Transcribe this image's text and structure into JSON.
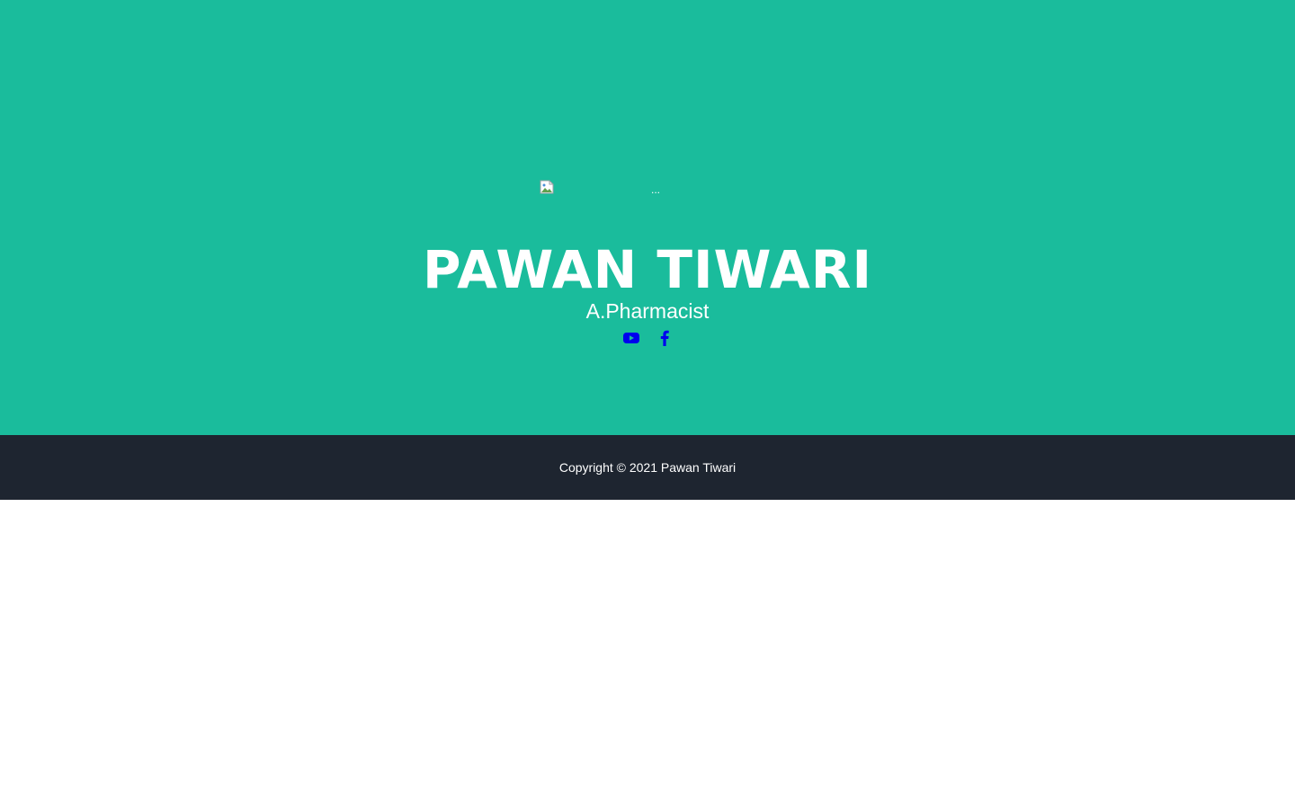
{
  "hero": {
    "background_color": "#1abc9c",
    "avatar": {
      "alt_text": "...",
      "icon": "broken-image-icon"
    },
    "name": "PAWAN TIWARI",
    "subtitle": "A.Pharmacist",
    "social_links": [
      {
        "icon": "youtube-icon",
        "color": "#0000ee"
      },
      {
        "icon": "facebook-icon",
        "color": "#0000ee"
      }
    ]
  },
  "footer": {
    "background_color": "#1e2530",
    "copyright": "Copyright © 2021 Pawan Tiwari"
  }
}
